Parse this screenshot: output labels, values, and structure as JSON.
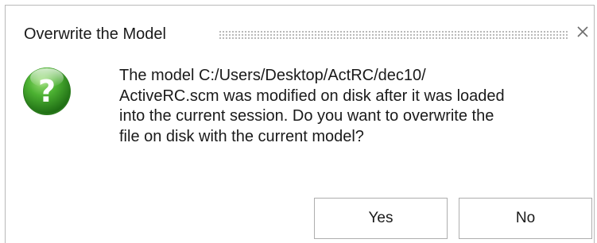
{
  "dialog": {
    "title": "Overwrite the Model",
    "close_icon": "close-icon",
    "icon": "question-icon",
    "icon_color": "#3a9b2a",
    "message_lines": [
      "The model C:/Users/Desktop/ActRC/dec10/",
      "ActiveRC.scm was modified on disk after it was loaded",
      "into the current session. Do you want to overwrite the",
      "file on disk with the current model?"
    ],
    "buttons": {
      "yes_label": "Yes",
      "no_label": "No"
    }
  }
}
